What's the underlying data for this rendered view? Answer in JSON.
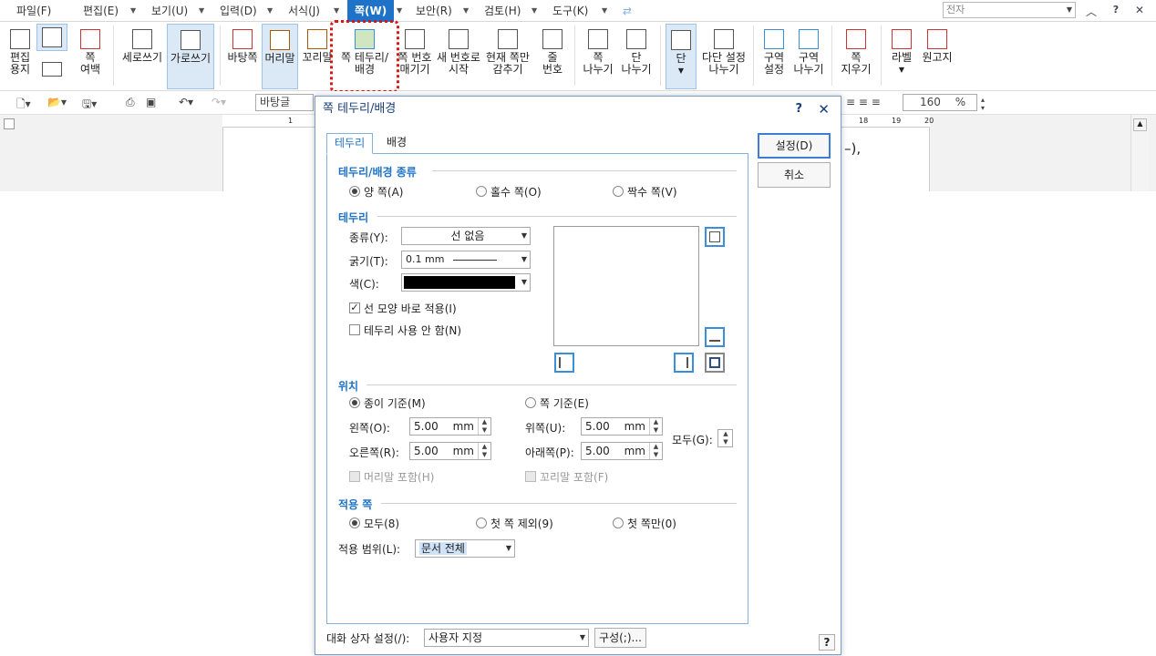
{
  "menubar": {
    "items": [
      "파일(F)",
      "편집(E)",
      "보기(U)",
      "입력(D)",
      "서식(J)",
      "쪽(W)",
      "보안(R)",
      "검토(H)",
      "도구(K)"
    ],
    "active": "쪽(W)",
    "search_value": "전자"
  },
  "ribbon": {
    "buttons": {
      "edit_paper": "편집\n용지",
      "page_margin": "쪽\n여백",
      "vertical_writing": "세로쓰기",
      "horizontal_writing": "가로쓰기",
      "background_page": "바탕쪽",
      "header": "머리말",
      "footer": "꼬리말",
      "page_border_bg": "쪽 테두리/\n배경",
      "page_number": "쪽 번호\n매기기",
      "new_number": "새 번호로\n시작",
      "hide_current": "현재 쪽만\n감추기",
      "line_number": "줄\n번호",
      "page_break": "쪽\n나누기",
      "column_break": "단\n나누기",
      "column": "단",
      "multi_column": "다단 설정\n나누기",
      "section_set": "구역\n설정",
      "section_break": "구역\n나누기",
      "delete_page": "쪽\n지우기",
      "label": "라벨",
      "manuscript": "원고지"
    }
  },
  "toolbar": {
    "style": "바탕글",
    "zoom": "160",
    "zoom_unit": "%"
  },
  "ruler": {
    "marks": [
      "1",
      "18",
      "19",
      "20"
    ]
  },
  "document": {
    "visible_text": "–),"
  },
  "dialog": {
    "title": "쪽 테두리/배경",
    "help": "?",
    "close": "✕",
    "tabs": [
      "테두리",
      "배경"
    ],
    "buttons": {
      "ok": "설정(D)",
      "cancel": "취소",
      "config": "구성(;)..."
    },
    "type_section": {
      "title": "테두리/배경 종류",
      "options": [
        "양 쪽(A)",
        "홀수 쪽(O)",
        "짝수 쪽(V)"
      ],
      "selected": 0
    },
    "border_section": {
      "title": "테두리",
      "type_label": "종류(Y):",
      "type_value": "선 없음",
      "thickness_label": "굵기(T):",
      "thickness_value": "0.1 mm",
      "color_label": "색(C):",
      "color_value": "#000000",
      "apply_shape_label": "선 모양 바로 적용(I)",
      "apply_shape_checked": true,
      "no_border_label": "테두리 사용 안 함(N)",
      "no_border_checked": false
    },
    "position_section": {
      "title": "위치",
      "options": [
        "종이 기준(M)",
        "쪽 기준(E)"
      ],
      "selected": 0,
      "left_label": "왼쪽(O):",
      "left_value": "5.00",
      "right_label": "오른쪽(R):",
      "right_value": "5.00",
      "top_label": "위쪽(U):",
      "top_value": "5.00",
      "bottom_label": "아래쪽(P):",
      "bottom_value": "5.00",
      "unit": "mm",
      "all_label": "모두(G):",
      "include_header": "머리말 포함(H)",
      "include_footer": "꼬리말 포함(F)"
    },
    "apply_section": {
      "title": "적용 쪽",
      "options": [
        "모두(8)",
        "첫 쪽 제외(9)",
        "첫 쪽만(0)"
      ],
      "selected": 0,
      "range_label": "적용 범위(L):",
      "range_value": "문서 전체"
    },
    "footer": {
      "settings_label": "대화 상자 설정(/):",
      "settings_value": "사용자 지정",
      "help": "?"
    }
  },
  "colors": {
    "accent": "#1e73c8",
    "highlight": "#d81818"
  }
}
